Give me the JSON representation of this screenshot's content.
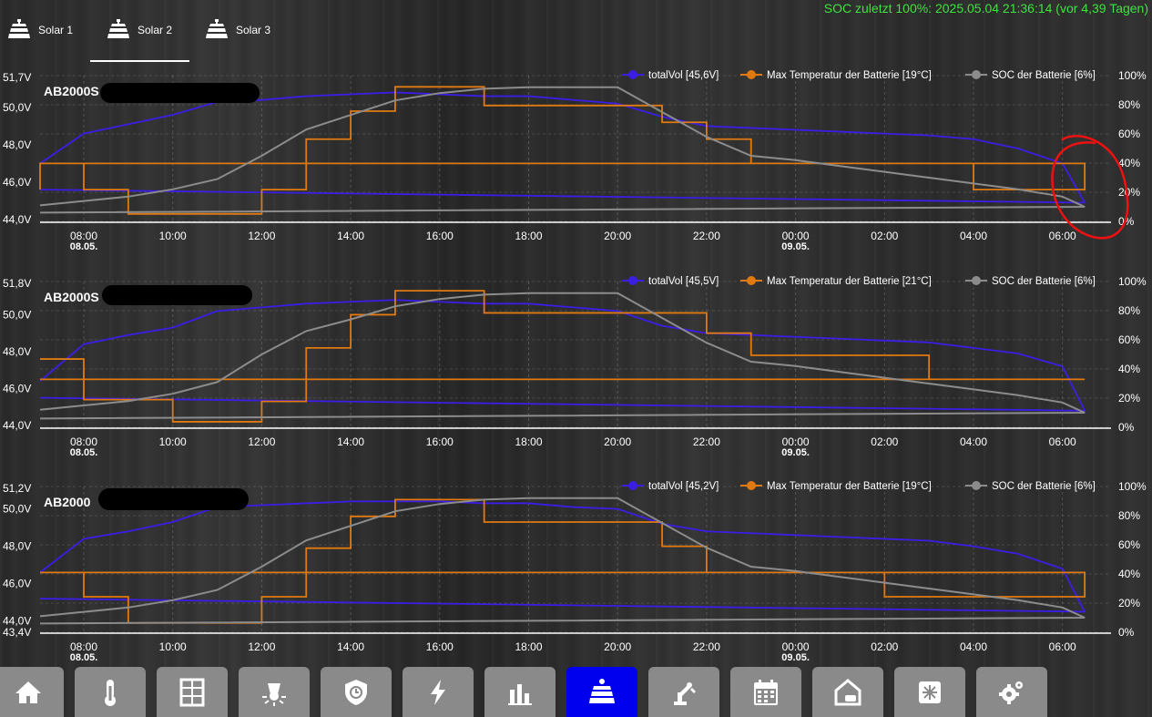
{
  "tabs": [
    {
      "label": "Solar 1",
      "active": false
    },
    {
      "label": "Solar 2",
      "active": true
    },
    {
      "label": "Solar 3",
      "active": false
    }
  ],
  "soc_note": "SOC zuletzt 100%: 2025.05.04 21:36:14  (vor 4,39 Tagen)",
  "colors": {
    "voltage": "#3a1ee6",
    "temperature": "#e07a10",
    "soc": "#8c8c8c",
    "active_nav": "#0000ee",
    "status_green": "#3fe23f"
  },
  "x_axis": {
    "ticks": [
      "08:00",
      "10:00",
      "12:00",
      "14:00",
      "16:00",
      "18:00",
      "20:00",
      "22:00",
      "00:00",
      "02:00",
      "04:00",
      "06:00"
    ],
    "date_labels": [
      {
        "tick": "08:00",
        "date": "08.05."
      },
      {
        "tick": "00:00",
        "date": "09.05."
      }
    ]
  },
  "charts": [
    {
      "title": "AB2000S",
      "legend": [
        "totalVol [45,6V]",
        "Max  Temperatur der Batterie [19°C]",
        "SOC der Batterie [6%]"
      ],
      "y_left_ticks": [
        "51,7V",
        "50,0V",
        "48,0V",
        "46,0V",
        "44,0V"
      ],
      "y_right_ticks": [
        "100%",
        "80%",
        "60%",
        "40%",
        "20%",
        "0%"
      ],
      "annotation": "red-circle-around-voltage-drop"
    },
    {
      "title": "AB2000S",
      "legend": [
        "totalVol [45,5V]",
        "Max  Temperatur der Batterie [21°C]",
        "SOC der Batterie [6%]"
      ],
      "y_left_ticks": [
        "51,8V",
        "50,0V",
        "48,0V",
        "46,0V",
        "44,0V"
      ],
      "y_right_ticks": [
        "100%",
        "80%",
        "60%",
        "40%",
        "20%",
        "0%"
      ]
    },
    {
      "title": "AB2000",
      "legend": [
        "totalVol [45,2V]",
        "Max  Temperatur der Batterie [19°C]",
        "SOC der Batterie [6%]"
      ],
      "y_left_ticks": [
        "51,2V",
        "50,0V",
        "48,0V",
        "46,0V",
        "44,0V",
        "43,4V"
      ],
      "y_right_ticks": [
        "100%",
        "80%",
        "60%",
        "40%",
        "20%",
        "0%"
      ]
    }
  ],
  "chart_data": [
    {
      "type": "line",
      "title": "AB2000S",
      "x": [
        "07:00",
        "08:00",
        "09:00",
        "10:00",
        "11:00",
        "12:00",
        "13:00",
        "14:00",
        "15:00",
        "16:00",
        "17:00",
        "18:00",
        "19:00",
        "20:00",
        "21:00",
        "22:00",
        "23:00",
        "00:00",
        "01:00",
        "02:00",
        "03:00",
        "04:00",
        "05:00",
        "06:00",
        "06:30",
        "07:00"
      ],
      "ylim_left": [
        43.9,
        51.7
      ],
      "ylim_right": [
        0,
        100
      ],
      "series": [
        {
          "name": "totalVol [45,6V]",
          "axis": "left",
          "values": [
            47.0,
            48.6,
            49.1,
            49.6,
            50.3,
            50.4,
            50.6,
            50.7,
            50.8,
            50.7,
            50.6,
            50.6,
            50.4,
            50.2,
            49.5,
            49.0,
            48.9,
            48.8,
            48.7,
            48.6,
            48.5,
            48.3,
            47.8,
            47.0,
            44.9,
            45.6
          ]
        },
        {
          "name": "Max  Temperatur der Batterie [19°C]",
          "axis": "left",
          "values": [
            47.0,
            45.6,
            44.3,
            44.3,
            44.3,
            45.6,
            48.3,
            49.8,
            51.1,
            51.1,
            50.1,
            50.1,
            50.1,
            50.1,
            49.2,
            48.3,
            47.0,
            47.0,
            47.0,
            47.0,
            47.0,
            45.6,
            45.6,
            45.6,
            47.0,
            45.6
          ]
        },
        {
          "name": "SOC der Batterie [6%]",
          "axis": "right",
          "values": [
            11,
            14,
            17,
            22,
            29,
            45,
            63,
            73,
            83,
            88,
            91,
            92,
            92,
            92,
            75,
            58,
            45,
            42,
            38,
            34,
            30,
            26,
            22,
            17,
            10,
            6
          ]
        }
      ]
    },
    {
      "type": "line",
      "title": "AB2000S",
      "x": [
        "07:00",
        "08:00",
        "09:00",
        "10:00",
        "11:00",
        "12:00",
        "13:00",
        "14:00",
        "15:00",
        "16:00",
        "17:00",
        "18:00",
        "19:00",
        "20:00",
        "21:00",
        "22:00",
        "23:00",
        "00:00",
        "01:00",
        "02:00",
        "03:00",
        "04:00",
        "05:00",
        "06:00",
        "06:30",
        "07:00"
      ],
      "ylim_left": [
        43.9,
        51.8
      ],
      "ylim_right": [
        0,
        100
      ],
      "series": [
        {
          "name": "totalVol [45,5V]",
          "axis": "left",
          "values": [
            46.4,
            48.4,
            48.9,
            49.3,
            50.2,
            50.4,
            50.6,
            50.7,
            50.8,
            50.7,
            50.6,
            50.6,
            50.4,
            50.2,
            49.4,
            49.0,
            48.9,
            48.8,
            48.7,
            48.6,
            48.5,
            48.2,
            47.9,
            47.2,
            44.8,
            45.5
          ]
        },
        {
          "name": "Max  Temperatur der Batterie [21°C]",
          "axis": "left",
          "values": [
            47.6,
            45.4,
            45.4,
            44.2,
            44.2,
            45.3,
            48.2,
            50.0,
            51.3,
            51.3,
            50.1,
            50.1,
            50.1,
            50.1,
            50.1,
            49.0,
            47.8,
            47.8,
            47.8,
            47.8,
            46.5,
            46.5,
            46.5,
            46.5,
            46.5,
            46.5
          ]
        },
        {
          "name": "SOC der Batterie [6%]",
          "axis": "right",
          "values": [
            12,
            15,
            18,
            23,
            31,
            50,
            66,
            74,
            83,
            88,
            91,
            92,
            92,
            92,
            75,
            58,
            45,
            42,
            38,
            34,
            30,
            26,
            22,
            17,
            10,
            6
          ]
        }
      ]
    },
    {
      "type": "line",
      "title": "AB2000",
      "x": [
        "07:00",
        "08:00",
        "09:00",
        "10:00",
        "11:00",
        "12:00",
        "13:00",
        "14:00",
        "15:00",
        "16:00",
        "17:00",
        "18:00",
        "19:00",
        "20:00",
        "21:00",
        "22:00",
        "23:00",
        "00:00",
        "01:00",
        "02:00",
        "03:00",
        "04:00",
        "05:00",
        "06:00",
        "06:30",
        "07:00"
      ],
      "ylim_left": [
        43.4,
        51.2
      ],
      "ylim_right": [
        0,
        100
      ],
      "series": [
        {
          "name": "totalVol [45,2V]",
          "axis": "left",
          "values": [
            46.6,
            48.4,
            48.8,
            49.3,
            50.1,
            50.2,
            50.3,
            50.4,
            50.4,
            50.4,
            50.3,
            50.3,
            50.1,
            50.0,
            49.2,
            48.8,
            48.7,
            48.6,
            48.5,
            48.4,
            48.3,
            48.0,
            47.6,
            46.8,
            44.5,
            45.2
          ]
        },
        {
          "name": "Max  Temperatur der Batterie [19°C]",
          "axis": "left",
          "values": [
            46.6,
            45.3,
            43.9,
            43.9,
            43.9,
            45.3,
            47.9,
            49.6,
            50.5,
            50.5,
            49.3,
            49.3,
            49.3,
            49.3,
            48.0,
            46.6,
            46.6,
            46.6,
            46.6,
            45.3,
            45.3,
            45.3,
            45.3,
            45.3,
            46.6,
            46.6
          ]
        },
        {
          "name": "SOC der Batterie [6%]",
          "axis": "right",
          "values": [
            11,
            14,
            17,
            22,
            29,
            45,
            63,
            73,
            83,
            88,
            91,
            92,
            92,
            92,
            75,
            58,
            45,
            42,
            38,
            34,
            30,
            26,
            22,
            17,
            10,
            6
          ]
        }
      ]
    }
  ],
  "nav": [
    {
      "name": "home",
      "icon": "home-icon",
      "active": false
    },
    {
      "name": "temperature",
      "icon": "thermometer-icon",
      "active": false
    },
    {
      "name": "windows",
      "icon": "window-icon",
      "active": false
    },
    {
      "name": "lighting",
      "icon": "lightbulb-icon",
      "active": false
    },
    {
      "name": "security",
      "icon": "shield-clock-icon",
      "active": false
    },
    {
      "name": "energy",
      "icon": "lightning-icon",
      "active": false
    },
    {
      "name": "statistics",
      "icon": "bar-chart-icon",
      "active": false
    },
    {
      "name": "solar",
      "icon": "solar-panel-icon",
      "active": true
    },
    {
      "name": "robot",
      "icon": "robot-arm-icon",
      "active": false
    },
    {
      "name": "calendar",
      "icon": "calendar-icon",
      "active": false
    },
    {
      "name": "garage",
      "icon": "house-car-icon",
      "active": false
    },
    {
      "name": "ventilation",
      "icon": "fan-icon",
      "active": false
    },
    {
      "name": "settings",
      "icon": "gears-icon",
      "active": false
    }
  ]
}
